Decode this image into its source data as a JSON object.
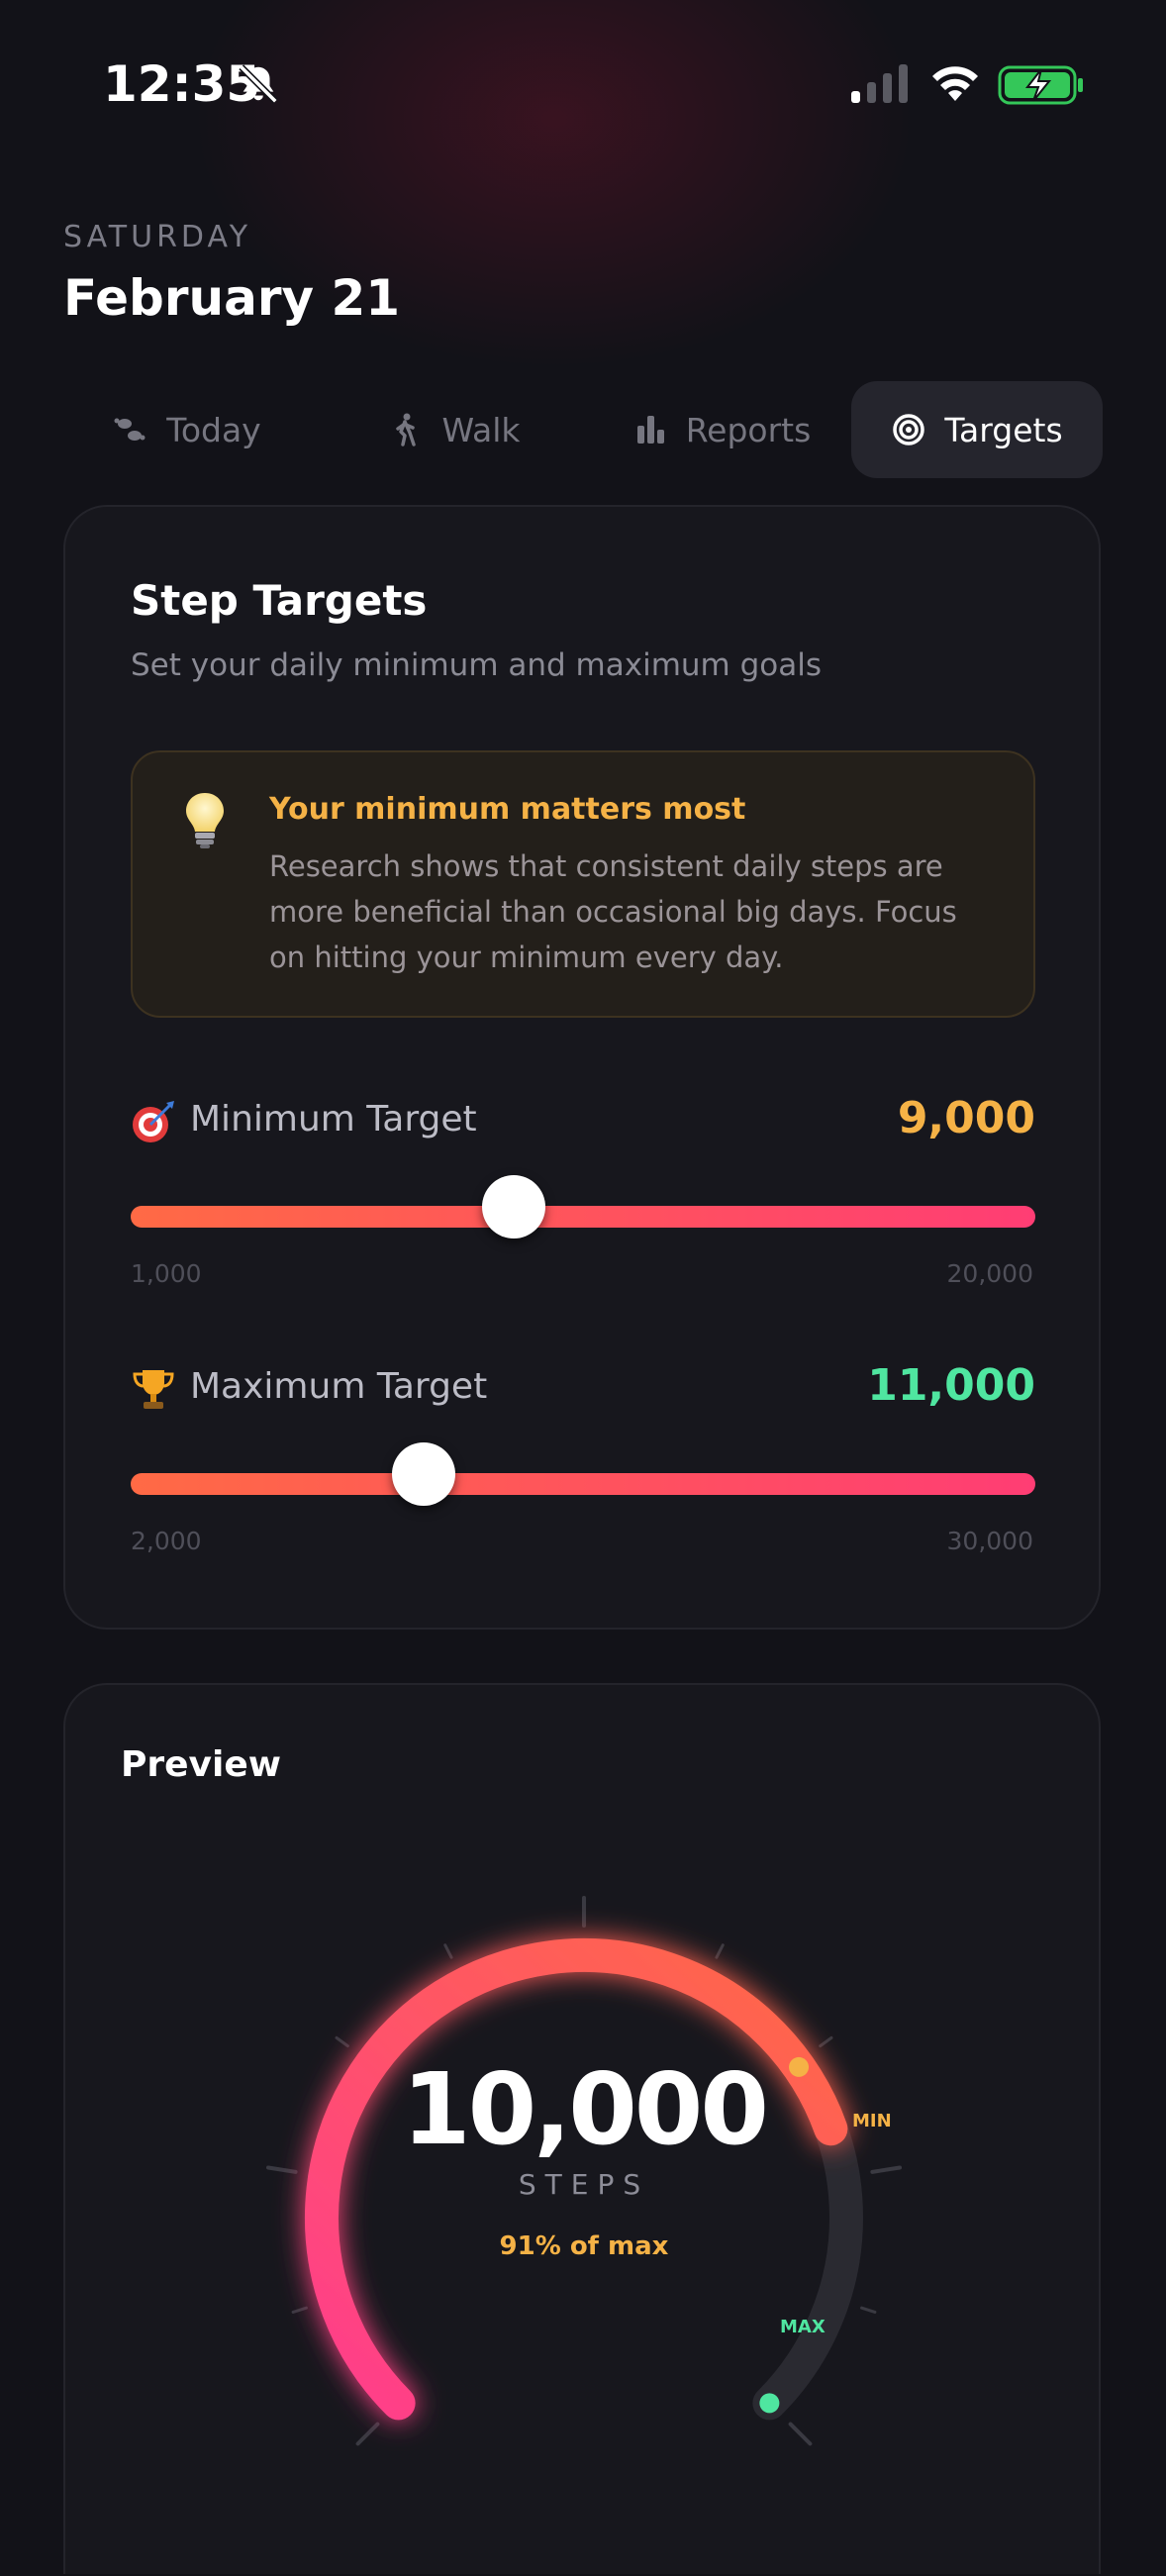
{
  "status_bar": {
    "time": "12:35"
  },
  "header": {
    "day": "SATURDAY",
    "date": "February 21"
  },
  "tabs": [
    {
      "label": "Today",
      "icon": "footprints-icon",
      "active": false
    },
    {
      "label": "Walk",
      "icon": "walking-person-icon",
      "active": false
    },
    {
      "label": "Reports",
      "icon": "bar-chart-icon",
      "active": false
    },
    {
      "label": "Targets",
      "icon": "target-icon",
      "active": true
    }
  ],
  "step_targets": {
    "title": "Step Targets",
    "subtitle": "Set your daily minimum and maximum goals",
    "tip": {
      "icon": "lightbulb-icon",
      "title": "Your minimum matters most",
      "body": "Research shows that consistent daily steps are more beneficial than occasional big days. Focus on hitting your minimum every day."
    },
    "minimum": {
      "icon": "dart-target-emoji",
      "label": "Minimum Target",
      "value": "9,000",
      "range_min": "1,000",
      "range_max": "20,000",
      "value_color": "#f5b246",
      "slider_value": 9000,
      "slider_min": 1000,
      "slider_max": 20000
    },
    "maximum": {
      "icon": "trophy-emoji",
      "label": "Maximum Target",
      "value": "11,000",
      "range_min": "2,000",
      "range_max": "30,000",
      "value_color": "#4fe6a0",
      "slider_value": 11000,
      "slider_min": 2000,
      "slider_max": 30000
    }
  },
  "preview": {
    "title": "Preview",
    "steps": "10,000",
    "unit": "STEPS",
    "percent_label": "91% of max",
    "min_marker": "MIN",
    "max_marker": "MAX",
    "colors": {
      "arc_start": "#ff3d8c",
      "arc_end": "#ff6a45",
      "min": "#f5b246",
      "max": "#4fe6a0"
    }
  }
}
